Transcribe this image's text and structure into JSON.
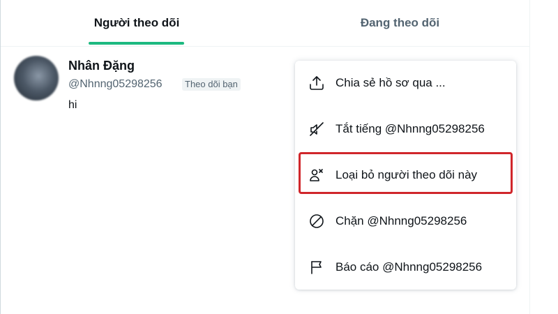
{
  "tabs": [
    {
      "label": "Người theo dõi",
      "active": true
    },
    {
      "label": "Đang theo dõi",
      "active": false
    }
  ],
  "follower": {
    "name": "Nhân Đặng",
    "handle": "@Nhnng05298256",
    "badge": "Theo dõi bạn",
    "bio": "hi"
  },
  "menu": {
    "items": [
      {
        "icon": "share-icon",
        "label": "Chia sẻ hồ sơ qua ..."
      },
      {
        "icon": "mute-icon",
        "label": "Tắt tiếng @Nhnng05298256"
      },
      {
        "icon": "remove-follower-icon",
        "label": "Loại bỏ người theo dõi này"
      },
      {
        "icon": "block-icon",
        "label": "Chặn @Nhnng05298256"
      },
      {
        "icon": "flag-icon",
        "label": "Báo cáo @Nhnng05298256"
      }
    ]
  },
  "colors": {
    "accent": "#1db980",
    "highlight": "#d0262b",
    "secondary_text": "#536471"
  }
}
